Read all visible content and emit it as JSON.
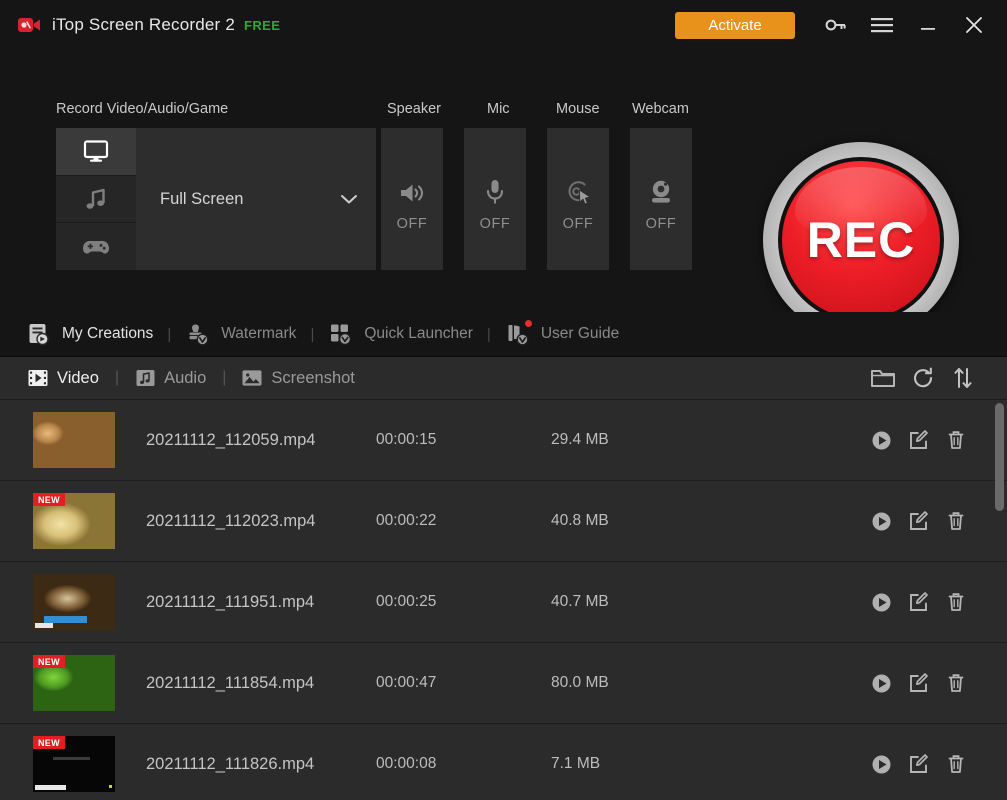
{
  "window": {
    "title": "iTop Screen Recorder 2",
    "edition_badge": "FREE",
    "logo_icon": "video-camera-icon",
    "accent_color": "#e8921c",
    "brand_red": "#e01e24",
    "free_green": "#2ea92e"
  },
  "titlebar": {
    "activate_label": "Activate",
    "key_icon": "key-icon",
    "menu_icon": "hamburger-menu-icon",
    "minimize_icon": "minimize-icon",
    "close_icon": "close-icon"
  },
  "record": {
    "source_group_label": "Record Video/Audio/Game",
    "modes": [
      {
        "name": "screen",
        "icon": "monitor-icon",
        "active": true
      },
      {
        "name": "audio",
        "icon": "music-note-icon",
        "active": false
      },
      {
        "name": "game",
        "icon": "gamepad-icon",
        "active": false
      }
    ],
    "source_selected": "Full Screen",
    "source_chevron_icon": "chevron-down-icon",
    "toggles": [
      {
        "label": "Speaker",
        "icon": "speaker-icon",
        "state": "OFF"
      },
      {
        "label": "Mic",
        "icon": "microphone-icon",
        "state": "OFF"
      },
      {
        "label": "Mouse",
        "icon": "mouse-click-icon",
        "state": "OFF"
      },
      {
        "label": "Webcam",
        "icon": "webcam-icon",
        "state": "OFF"
      }
    ],
    "rec_button_label": "REC"
  },
  "features": [
    {
      "label": "My Creations",
      "icon": "my-creations-icon",
      "highlight": true,
      "badge": false
    },
    {
      "label": "Watermark",
      "icon": "watermark-stamp-icon",
      "highlight": false,
      "badge": false
    },
    {
      "label": "Quick Launcher",
      "icon": "quick-launcher-grid-icon",
      "highlight": false,
      "badge": false
    },
    {
      "label": "User Guide",
      "icon": "user-guide-book-icon",
      "highlight": false,
      "badge": true
    }
  ],
  "feature_separator": "|",
  "library": {
    "tabs": [
      {
        "label": "Video",
        "icon": "film-strip-icon",
        "active": true
      },
      {
        "label": "Audio",
        "icon": "audio-note-icon",
        "active": false
      },
      {
        "label": "Screenshot",
        "icon": "image-picture-icon",
        "active": false
      }
    ],
    "tab_separator": "|",
    "tools": [
      {
        "name": "open-folder-icon",
        "title": "open-folder"
      },
      {
        "name": "refresh-icon",
        "title": "refresh"
      },
      {
        "name": "sort-icon",
        "title": "sort"
      }
    ],
    "row_actions": [
      {
        "name": "play-icon"
      },
      {
        "name": "edit-icon"
      },
      {
        "name": "delete-icon"
      }
    ],
    "files": [
      {
        "name": "20211112_112059.mp4",
        "duration": "00:00:15",
        "size": "29.4 MB",
        "is_new": false,
        "badge": "",
        "thumb": "th-nuts"
      },
      {
        "name": "20211112_112023.mp4",
        "duration": "00:00:22",
        "size": "40.8 MB",
        "is_new": true,
        "badge": "NEW",
        "thumb": "th-cup"
      },
      {
        "name": "20211112_111951.mp4",
        "duration": "00:00:25",
        "size": "40.7 MB",
        "is_new": false,
        "badge": "",
        "thumb": "th-choc"
      },
      {
        "name": "20211112_111854.mp4",
        "duration": "00:00:47",
        "size": "80.0 MB",
        "is_new": true,
        "badge": "NEW",
        "thumb": "th-grass"
      },
      {
        "name": "20211112_111826.mp4",
        "duration": "00:00:08",
        "size": "7.1 MB",
        "is_new": true,
        "badge": "NEW",
        "thumb": "th-black"
      }
    ]
  }
}
